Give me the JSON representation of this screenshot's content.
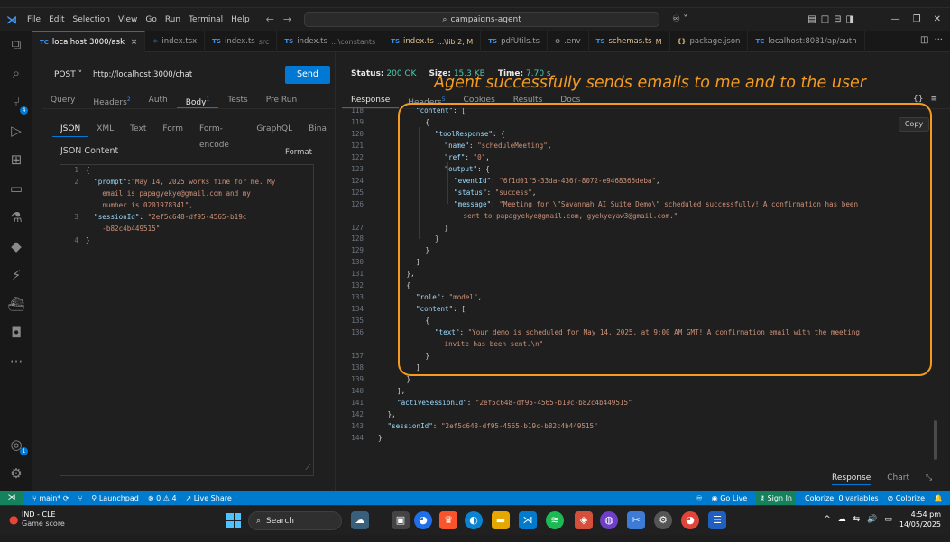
{
  "titlebar": {
    "menu": [
      "File",
      "Edit",
      "Selection",
      "View",
      "Go",
      "Run",
      "Terminal",
      "Help"
    ],
    "command_center": "campaigns-agent"
  },
  "tabs": [
    {
      "type": "TC",
      "label": "localhost:3000/ask",
      "desc": "",
      "active": true,
      "close": "×"
    },
    {
      "type": "⚛",
      "label": "index.tsx",
      "desc": "",
      "active": false
    },
    {
      "type": "TS",
      "label": "index.ts",
      "desc": "src",
      "active": false
    },
    {
      "type": "TS",
      "label": "index.ts",
      "desc": "...\\constants",
      "active": false
    },
    {
      "type": "TS",
      "label": "index.ts",
      "desc": "...\\lib 2, M",
      "active": false,
      "modified": true
    },
    {
      "type": "TS",
      "label": "pdfUtils.ts",
      "desc": "",
      "active": false
    },
    {
      "type": "⚙",
      "label": ".env",
      "desc": "",
      "active": false
    },
    {
      "type": "TS",
      "label": "schemas.ts",
      "desc": "M",
      "active": false,
      "modified": true
    },
    {
      "type": "{}",
      "label": "package.json",
      "desc": "",
      "active": false
    },
    {
      "type": "TC",
      "label": "localhost:8081/ap/auth",
      "desc": "",
      "active": false
    }
  ],
  "request": {
    "method": "POST",
    "url": "http://localhost:3000/chat",
    "send_label": "Send",
    "tabs": [
      {
        "label": "Query",
        "count": ""
      },
      {
        "label": "Headers",
        "count": "2"
      },
      {
        "label": "Auth",
        "count": ""
      },
      {
        "label": "Body",
        "count": "1",
        "active": true
      },
      {
        "label": "Tests",
        "count": ""
      },
      {
        "label": "Pre Run",
        "count": ""
      }
    ],
    "body_types": [
      "JSON",
      "XML",
      "Text",
      "Form",
      "Form-encode",
      "GraphQL",
      "Bina"
    ],
    "json_content_label": "JSON Content",
    "format_label": "Format",
    "body_lines": [
      {
        "n": "1",
        "text": "{"
      },
      {
        "n": "2",
        "key": "\"prompt\"",
        "val": "\"May 14, 2025 works fine for me. My"
      },
      {
        "n": "",
        "cont": "email is papagyekye@gmail.com and my"
      },
      {
        "n": "",
        "cont": "number is 0201978341\","
      },
      {
        "n": "3",
        "key": "\"sessionId\"",
        "val": "\"2ef5c648-df95-4565-b19c"
      },
      {
        "n": "",
        "cont": "-b82c4b449515\""
      },
      {
        "n": "4",
        "text": "}"
      }
    ]
  },
  "response": {
    "status_label": "Status:",
    "status_value": "200 OK",
    "size_label": "Size:",
    "size_value": "15.3 KB",
    "time_label": "Time:",
    "time_value": "7.70 s",
    "tabs": [
      {
        "label": "Response",
        "count": "",
        "active": true
      },
      {
        "label": "Headers",
        "count": "5"
      },
      {
        "label": "Cookies",
        "count": ""
      },
      {
        "label": "Results",
        "count": ""
      },
      {
        "label": "Docs",
        "count": ""
      }
    ],
    "copy_label": "Copy",
    "bottom_tabs": [
      "Response",
      "Chart"
    ],
    "annotation": "Agent successfully sends emails to me and to the user",
    "lines": [
      {
        "n": "118",
        "indent": 4,
        "key": "\"content\"",
        "tail": ": ["
      },
      {
        "n": "119",
        "indent": 5,
        "text": "{"
      },
      {
        "n": "120",
        "indent": 6,
        "key": "\"toolResponse\"",
        "tail": ": {"
      },
      {
        "n": "121",
        "indent": 7,
        "key": "\"name\"",
        "val": "\"scheduleMeeting\"",
        "comma": ","
      },
      {
        "n": "122",
        "indent": 7,
        "key": "\"ref\"",
        "val": "\"0\"",
        "comma": ","
      },
      {
        "n": "123",
        "indent": 7,
        "key": "\"output\"",
        "tail": ": {"
      },
      {
        "n": "124",
        "indent": 8,
        "key": "\"eventId\"",
        "val": "\"6f1d01f5-33da-436f-8072-e9468365deba\"",
        "comma": ","
      },
      {
        "n": "125",
        "indent": 8,
        "key": "\"status\"",
        "val": "\"success\"",
        "comma": ","
      },
      {
        "n": "126",
        "indent": 8,
        "key": "\"message\"",
        "val": "\"Meeting for \\\"Savannah AI Suite Demo\\\" scheduled successfully! A confirmation has been",
        "comma": ""
      },
      {
        "n": "",
        "indent": 9,
        "cont": "sent to papagyekye@gmail.com, gyekyeyaw3@gmail.com.\""
      },
      {
        "n": "127",
        "indent": 7,
        "text": "}"
      },
      {
        "n": "128",
        "indent": 6,
        "text": "}"
      },
      {
        "n": "129",
        "indent": 5,
        "text": "}"
      },
      {
        "n": "130",
        "indent": 4,
        "text": "]"
      },
      {
        "n": "131",
        "indent": 3,
        "text": "},"
      },
      {
        "n": "132",
        "indent": 3,
        "text": "{"
      },
      {
        "n": "133",
        "indent": 4,
        "key": "\"role\"",
        "val": "\"model\"",
        "comma": ","
      },
      {
        "n": "134",
        "indent": 4,
        "key": "\"content\"",
        "tail": ": ["
      },
      {
        "n": "135",
        "indent": 5,
        "text": "{"
      },
      {
        "n": "136",
        "indent": 6,
        "key": "\"text\"",
        "val": "\"Your demo is scheduled for May 14, 2025, at 9:00 AM GMT! A confirmation email with the meeting",
        "comma": ""
      },
      {
        "n": "",
        "indent": 7,
        "cont": "invite has been sent.\\n\""
      },
      {
        "n": "137",
        "indent": 5,
        "text": "}"
      },
      {
        "n": "138",
        "indent": 4,
        "text": "]"
      },
      {
        "n": "139",
        "indent": 3,
        "text": "}"
      },
      {
        "n": "140",
        "indent": 2,
        "text": "],"
      },
      {
        "n": "141",
        "indent": 2,
        "key": "\"activeSessionId\"",
        "val": "\"2ef5c648-df95-4565-b19c-b82c4b449515\"",
        "comma": ""
      },
      {
        "n": "142",
        "indent": 1,
        "text": "},"
      },
      {
        "n": "143",
        "indent": 1,
        "key": "\"sessionId\"",
        "val": "\"2ef5c648-df95-4565-b19c-b82c4b449515\"",
        "comma": ""
      },
      {
        "n": "144",
        "indent": 0,
        "text": "}"
      }
    ]
  },
  "statusbar": {
    "branch": "main*",
    "launchpad": "Launchpad",
    "problems": "⊗ 0 ⚠ 4",
    "live_share": "Live Share",
    "go_live": "Go Live",
    "sign_in": "Sign In",
    "colorize_vars": "Colorize: 0 variables",
    "colorize": "Colorize"
  },
  "taskbar": {
    "weather_title": "IND - CLE",
    "weather_sub": "Game score",
    "search_label": "Search",
    "time": "4:54 pm",
    "date": "14/05/2025"
  },
  "colors": {
    "accent": "#0078d4",
    "annotation": "#f59b22",
    "status_ok": "#4ec9b0",
    "json_key": "#9cdcfe",
    "json_string": "#ce9178"
  }
}
